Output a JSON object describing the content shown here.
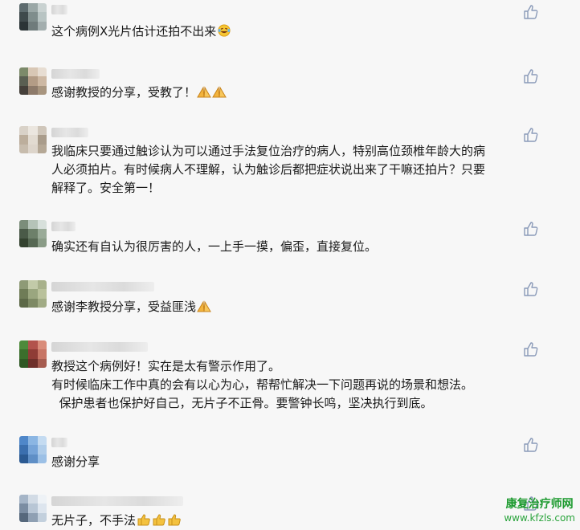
{
  "comments": [
    {
      "text": "这个病例X光片估计还拍不出来",
      "emoji": "laughing-tears-icon",
      "emoji_count": 1
    },
    {
      "text": "感谢教授的分享，受教了！",
      "emoji": "folded-hands-icon",
      "emoji_count": 2
    },
    {
      "text": "我临床只要通过触诊认为可以通过手法复位治疗的病人，特别高位颈椎年龄大的病\n人必须拍片。有时候病人不理解，认为触诊后都把症状说出来了干嘛还拍片？只要\n解释了。安全第一！",
      "emoji": "",
      "emoji_count": 0
    },
    {
      "text": "确实还有自认为很厉害的人，一上手一摸，偏歪，直接复位。",
      "emoji": "",
      "emoji_count": 0
    },
    {
      "text": "感谢李教授分享，受益匪浅",
      "emoji": "folded-hands-icon",
      "emoji_count": 1
    },
    {
      "text": "教授这个病例好！实在是太有警示作用了。\n有时候临床工作中真的会有以心为心，帮帮忙解决一下问题再说的场景和想法。\n  保护患者也保护好自己，无片子不正骨。要警钟长鸣，坚决执行到底。",
      "emoji": "",
      "emoji_count": 0
    },
    {
      "text": "感谢分享",
      "emoji": "",
      "emoji_count": 0
    },
    {
      "text": "无片子，不手法",
      "emoji": "thumbs-up-icon",
      "emoji_count": 3
    }
  ],
  "like_icon": "thumbs-up-outline-icon",
  "watermark": {
    "line1": "康复治疗师网",
    "line2": "www.kfzls.com",
    "color": "#1c9a2e"
  },
  "colors": {
    "background": "#f7f7f7",
    "text": "#1a1a1a",
    "like_icon": "#8a9ab8"
  }
}
